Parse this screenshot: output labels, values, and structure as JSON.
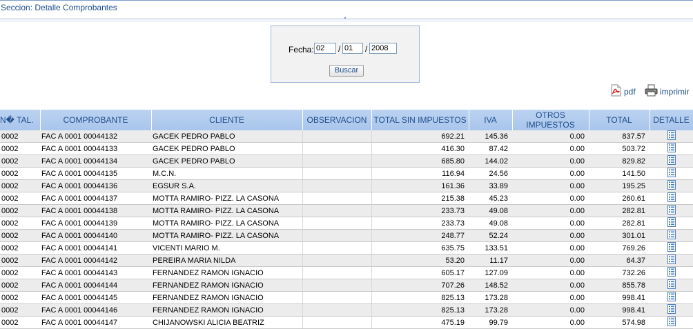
{
  "section": {
    "title": "Seccion: Detalle Comprobantes"
  },
  "filter": {
    "fecha_label": "Fecha:",
    "day": "02",
    "month": "01",
    "year": "2008",
    "separator": "/",
    "buscar_label": "Buscar"
  },
  "exports": {
    "pdf_label": "pdf",
    "print_label": "imprimir"
  },
  "table": {
    "headers": {
      "n_tal": "N\u0000 TAL.",
      "comprobante": "COMPROBANTE",
      "cliente": "CLIENTE",
      "observacion": "OBSERVACION",
      "total_sin": "TOTAL SIN IMPUESTOS",
      "iva": "IVA",
      "otros": "OTROS IMPUESTOS",
      "total": "TOTAL",
      "detalle": "DETALLE"
    },
    "rows": [
      {
        "tal": "0002",
        "comp": "FAC A 0001 00044132",
        "cliente": "GACEK PEDRO PABLO",
        "obs": "",
        "sin": "692.21",
        "iva": "145.36",
        "otros": "0.00",
        "total": "837.57"
      },
      {
        "tal": "0002",
        "comp": "FAC A 0001 00044133",
        "cliente": "GACEK PEDRO PABLO",
        "obs": "",
        "sin": "416.30",
        "iva": "87.42",
        "otros": "0.00",
        "total": "503.72"
      },
      {
        "tal": "0002",
        "comp": "FAC A 0001 00044134",
        "cliente": "GACEK PEDRO PABLO",
        "obs": "",
        "sin": "685.80",
        "iva": "144.02",
        "otros": "0.00",
        "total": "829.82"
      },
      {
        "tal": "0002",
        "comp": "FAC A 0001 00044135",
        "cliente": "M.C.N.",
        "obs": "",
        "sin": "116.94",
        "iva": "24.56",
        "otros": "0.00",
        "total": "141.50"
      },
      {
        "tal": "0002",
        "comp": "FAC A 0001 00044136",
        "cliente": "EGSUR S.A.",
        "obs": "",
        "sin": "161.36",
        "iva": "33.89",
        "otros": "0.00",
        "total": "195.25"
      },
      {
        "tal": "0002",
        "comp": "FAC A 0001 00044137",
        "cliente": "MOTTA RAMIRO- PIZZ. LA CASONA",
        "obs": "",
        "sin": "215.38",
        "iva": "45.23",
        "otros": "0.00",
        "total": "260.61"
      },
      {
        "tal": "0002",
        "comp": "FAC A 0001 00044138",
        "cliente": "MOTTA RAMIRO- PIZZ. LA CASONA",
        "obs": "",
        "sin": "233.73",
        "iva": "49.08",
        "otros": "0.00",
        "total": "282.81"
      },
      {
        "tal": "0002",
        "comp": "FAC A 0001 00044139",
        "cliente": "MOTTA RAMIRO- PIZZ. LA CASONA",
        "obs": "",
        "sin": "233.73",
        "iva": "49.08",
        "otros": "0.00",
        "total": "282.81"
      },
      {
        "tal": "0002",
        "comp": "FAC A 0001 00044140",
        "cliente": "MOTTA RAMIRO- PIZZ. LA CASONA",
        "obs": "",
        "sin": "248.77",
        "iva": "52.24",
        "otros": "0.00",
        "total": "301.01"
      },
      {
        "tal": "0002",
        "comp": "FAC A 0001 00044141",
        "cliente": "VICENTI MARIO M.",
        "obs": "",
        "sin": "635.75",
        "iva": "133.51",
        "otros": "0.00",
        "total": "769.26"
      },
      {
        "tal": "0002",
        "comp": "FAC A 0001 00044142",
        "cliente": "PEREIRA MARIA NILDA",
        "obs": "",
        "sin": "53.20",
        "iva": "11.17",
        "otros": "0.00",
        "total": "64.37"
      },
      {
        "tal": "0002",
        "comp": "FAC A 0001 00044143",
        "cliente": "FERNANDEZ RAMON IGNACIO",
        "obs": "",
        "sin": "605.17",
        "iva": "127.09",
        "otros": "0.00",
        "total": "732.26"
      },
      {
        "tal": "0002",
        "comp": "FAC A 0001 00044144",
        "cliente": "FERNANDEZ RAMON IGNACIO",
        "obs": "",
        "sin": "707.26",
        "iva": "148.52",
        "otros": "0.00",
        "total": "855.78"
      },
      {
        "tal": "0002",
        "comp": "FAC A 0001 00044145",
        "cliente": "FERNANDEZ RAMON IGNACIO",
        "obs": "",
        "sin": "825.13",
        "iva": "173.28",
        "otros": "0.00",
        "total": "998.41"
      },
      {
        "tal": "0002",
        "comp": "FAC A 0001 00044146",
        "cliente": "FERNANDEZ RAMON IGNACIO",
        "obs": "",
        "sin": "825.13",
        "iva": "173.28",
        "otros": "0.00",
        "total": "998.41"
      },
      {
        "tal": "0002",
        "comp": "FAC A 0001 00044147",
        "cliente": "CHIJANOWSKI ALICIA BEATRIZ",
        "obs": "",
        "sin": "475.19",
        "iva": "99.79",
        "otros": "0.00",
        "total": "574.98"
      }
    ]
  },
  "icons": {
    "pdf": "pdf-file-icon",
    "print": "printer-icon",
    "detail": "detail-list-icon"
  },
  "colors": {
    "header_bg": "#bcd3f1",
    "header_text": "#1f4e8c",
    "row_alt": "#ececec"
  }
}
